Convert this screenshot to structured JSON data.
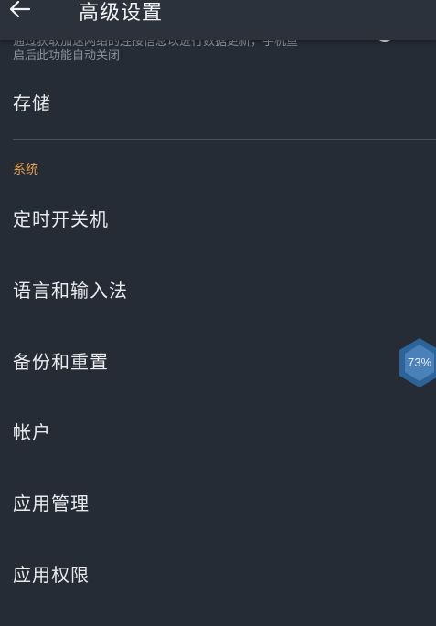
{
  "header": {
    "title": "高级设置",
    "back_icon": "arrow-left-icon"
  },
  "partial_setting": {
    "line1": "通过获取加速网络的连接信息以进行数据更新，手机重",
    "line2": "启后此功能自动关闭",
    "toggle_state": "on"
  },
  "items_top": [
    {
      "label": "存储"
    }
  ],
  "section_system": {
    "title": "系统",
    "color": "#e39d4d"
  },
  "items_system": [
    {
      "label": "定时开关机"
    },
    {
      "label": "语言和输入法"
    },
    {
      "label": "备份和重置"
    },
    {
      "label": "帐户"
    },
    {
      "label": "应用管理"
    },
    {
      "label": "应用权限"
    }
  ],
  "floating_badge": {
    "text": "73%",
    "icon": "hexagon-badge-icon"
  },
  "colors": {
    "background": "#262c35",
    "appbar": "#2b323c",
    "accent": "#e39d4d",
    "badge": "#3a6ea5"
  }
}
